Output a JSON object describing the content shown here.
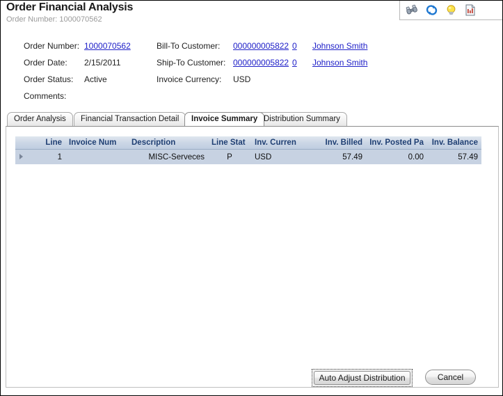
{
  "header": {
    "title": "Order Financial Analysis",
    "subtitle": "Order Number: 1000070562"
  },
  "toolbar": {
    "items": [
      {
        "name": "binoculars-icon",
        "label": "Search"
      },
      {
        "name": "refresh-icon",
        "label": "Refresh"
      },
      {
        "name": "lightbulb-icon",
        "label": "Hints"
      },
      {
        "name": "report-icon",
        "label": "Report"
      }
    ]
  },
  "details": {
    "order_number_label": "Order Number:",
    "order_number_value": "1000070562",
    "order_date_label": "Order Date:",
    "order_date_value": "2/15/2011",
    "order_status_label": "Order Status:",
    "order_status_value": "Active",
    "comments_label": "Comments:",
    "comments_value": "",
    "bill_to_label": "Bill-To Customer:",
    "bill_to_value": "000000005822",
    "bill_to_seq": "0",
    "bill_to_name": "Johnson Smith",
    "ship_to_label": "Ship-To Customer:",
    "ship_to_value": "000000005822",
    "ship_to_seq": "0",
    "ship_to_name": "Johnson Smith",
    "invoice_currency_label": "Invoice Currency:",
    "invoice_currency_value": "USD"
  },
  "tabs": [
    {
      "label": "Order Analysis",
      "active": false
    },
    {
      "label": "Financial Transaction Detail",
      "active": false
    },
    {
      "label": "Invoice Summary",
      "active": true
    },
    {
      "label": "Distribution Summary",
      "active": false
    }
  ],
  "grid": {
    "columns": [
      "Line",
      "Invoice Num",
      "Description",
      "Line Stat",
      "Inv. Curren",
      "Inv. Billed",
      "Inv. Posted Pa",
      "Inv. Balance"
    ],
    "rows": [
      {
        "line": "1",
        "invoice_num": "",
        "description": "MISC-Serveces",
        "line_stat": "P",
        "inv_curren": "USD",
        "inv_billed": "57.49",
        "inv_posted_pa": "0.00",
        "inv_balance": "57.49"
      }
    ]
  },
  "footer": {
    "auto_adjust_label": "Auto Adjust Distribution",
    "cancel_label": "Cancel"
  },
  "colors": {
    "link": "#1f20c8",
    "grid_header_text": "#1f3f73",
    "grid_row_bg": "#c7d2e2"
  }
}
